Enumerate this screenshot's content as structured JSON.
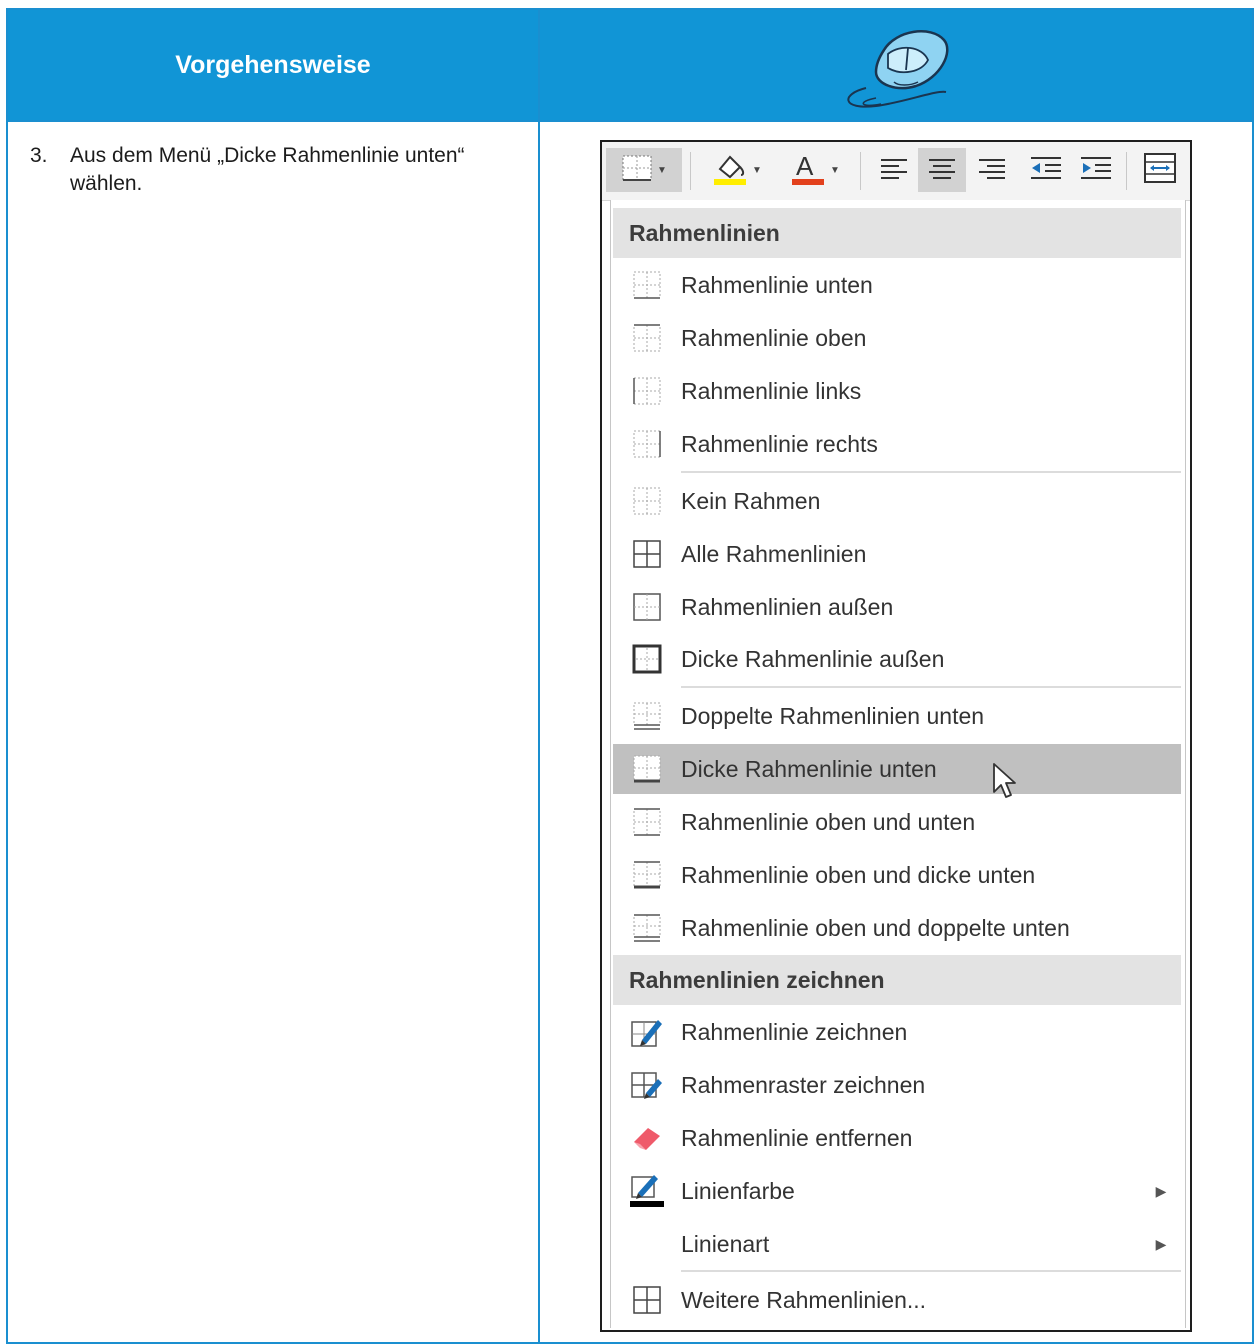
{
  "header": {
    "title": "Vorgehensweise"
  },
  "step": {
    "number": "3.",
    "text": "Aus dem Menü „Dicke Rahmenlinie unten“ wählen."
  },
  "menu": {
    "section1_title": "Rahmenlinien",
    "section2_title": "Rahmenlinien zeichnen",
    "items": [
      {
        "label": "Rahmenlinie unten",
        "icon": "border-bottom-icon"
      },
      {
        "label": "Rahmenlinie oben",
        "icon": "border-top-icon"
      },
      {
        "label": "Rahmenlinie links",
        "icon": "border-left-icon"
      },
      {
        "label": "Rahmenlinie rechts",
        "icon": "border-right-icon"
      },
      {
        "label": "Kein Rahmen",
        "icon": "no-border-icon"
      },
      {
        "label": "Alle Rahmenlinien",
        "icon": "all-borders-icon"
      },
      {
        "label": "Rahmenlinien außen",
        "icon": "outside-borders-icon"
      },
      {
        "label": "Dicke Rahmenlinie außen",
        "icon": "thick-outside-border-icon"
      },
      {
        "label": "Doppelte Rahmenlinien unten",
        "icon": "double-bottom-border-icon"
      },
      {
        "label": "Dicke Rahmenlinie unten",
        "icon": "thick-bottom-border-icon"
      },
      {
        "label": "Rahmenlinie oben und unten",
        "icon": "top-bottom-border-icon"
      },
      {
        "label": "Rahmenlinie oben und dicke unten",
        "icon": "top-thick-bottom-border-icon"
      },
      {
        "label": "Rahmenlinie oben und doppelte unten",
        "icon": "top-double-bottom-border-icon"
      }
    ],
    "draw_items": [
      {
        "label": "Rahmenlinie zeichnen",
        "icon": "draw-border-icon"
      },
      {
        "label": "Rahmenraster zeichnen",
        "icon": "draw-border-grid-icon"
      },
      {
        "label": "Rahmenlinie entfernen",
        "icon": "eraser-icon"
      },
      {
        "label": "Linienfarbe",
        "icon": "line-color-icon"
      },
      {
        "label": "Linienart",
        "icon": "line-style-icon"
      },
      {
        "label": "Weitere Rahmenlinien...",
        "icon": "more-borders-icon"
      }
    ]
  },
  "colors": {
    "accent": "#1195d6",
    "fill_color_bar": "#ffee00",
    "font_color_bar": "#e2401c",
    "highlight": "#c0c0c0"
  }
}
